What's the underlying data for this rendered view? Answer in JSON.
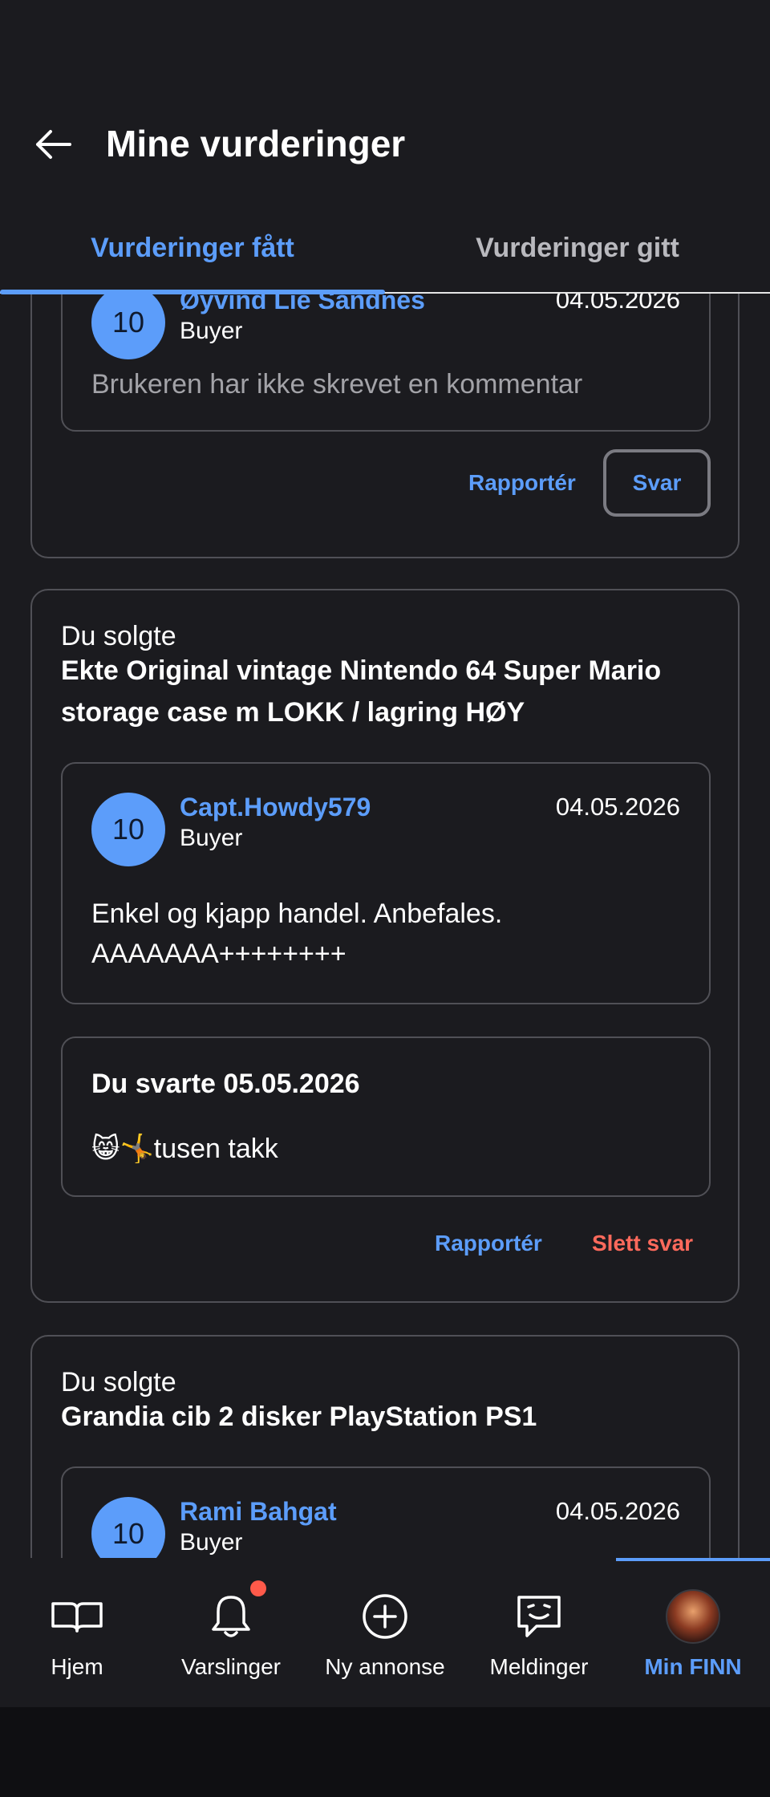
{
  "header": {
    "title": "Mine vurderinger",
    "tabs": [
      {
        "label": "Vurderinger fått",
        "active": true
      },
      {
        "label": "Vurderinger gitt",
        "active": false
      }
    ]
  },
  "reviews": [
    {
      "reviewer": "Øyvind Lie Sandnes",
      "role": "Buyer",
      "score": "10",
      "date": "04.05.2026",
      "comment": "Brukeren har ikke skrevet en kommentar",
      "actions": {
        "report": "Rapportér",
        "reply": "Svar"
      }
    },
    {
      "sold_label": "Du solgte",
      "item_title": "Ekte Original vintage Nintendo 64 Super Mario storage case m LOKK / lagring HØY",
      "reviewer": "Capt.Howdy579",
      "role": "Buyer",
      "score": "10",
      "date": "04.05.2026",
      "comment_line1": "Enkel og kjapp handel. Anbefales.",
      "comment_line2": "AAAAAAA++++++++",
      "reply_heading": "Du svarte 05.05.2026",
      "reply_text": "😸🤸tusen takk",
      "actions": {
        "report": "Rapportér",
        "delete_reply": "Slett svar"
      }
    },
    {
      "sold_label": "Du solgte",
      "item_title": "Grandia cib 2 disker PlayStation PS1",
      "reviewer": "Rami Bahgat",
      "role": "Buyer",
      "score": "10",
      "date": "04.05.2026"
    }
  ],
  "bottom_nav": {
    "items": [
      {
        "label": "Hjem",
        "icon": "book-open-icon"
      },
      {
        "label": "Varslinger",
        "icon": "bell-icon",
        "badge": true
      },
      {
        "label": "Ny annonse",
        "icon": "plus-circle-icon"
      },
      {
        "label": "Meldinger",
        "icon": "chat-smile-icon"
      },
      {
        "label": "Min FINN",
        "icon": "profile-avatar",
        "active": true
      }
    ]
  },
  "colors": {
    "background": "#1b1b1f",
    "accent": "#5c9dfa",
    "danger": "#ff6a5c",
    "border": "#505056"
  }
}
